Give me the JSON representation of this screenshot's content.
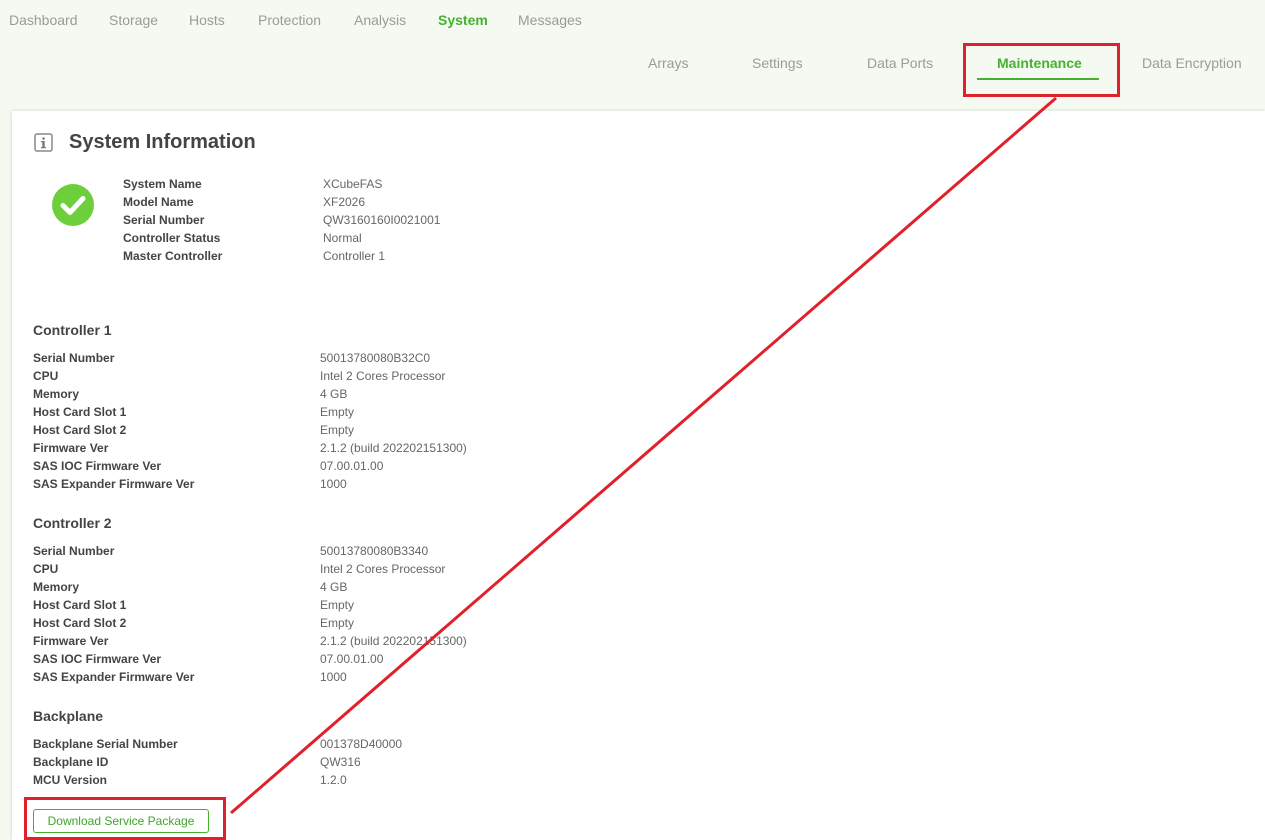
{
  "top_nav": {
    "items": [
      {
        "label": "Dashboard"
      },
      {
        "label": "Storage"
      },
      {
        "label": "Hosts"
      },
      {
        "label": "Protection"
      },
      {
        "label": "Analysis"
      },
      {
        "label": "System"
      },
      {
        "label": "Messages"
      }
    ],
    "active": "System"
  },
  "sub_nav": {
    "items": [
      {
        "label": "Arrays"
      },
      {
        "label": "Settings"
      },
      {
        "label": "Data Ports"
      },
      {
        "label": "Maintenance"
      },
      {
        "label": "Data Encryption"
      }
    ],
    "active": "Maintenance"
  },
  "panel": {
    "title": "System Information",
    "icon": "info-icon",
    "status_icon": "check-circle-icon"
  },
  "system": {
    "rows": [
      {
        "label": "System Name",
        "value": "XCubeFAS"
      },
      {
        "label": "Model Name",
        "value": "XF2026"
      },
      {
        "label": "Serial Number",
        "value": "QW3160160I0021001"
      },
      {
        "label": "Controller Status",
        "value": "Normal"
      },
      {
        "label": "Master Controller",
        "value": "Controller 1"
      }
    ]
  },
  "controller1": {
    "title": "Controller 1",
    "rows": [
      {
        "label": "Serial Number",
        "value": "50013780080B32C0"
      },
      {
        "label": "CPU",
        "value": "Intel 2 Cores Processor"
      },
      {
        "label": "Memory",
        "value": "4 GB"
      },
      {
        "label": "Host Card Slot 1",
        "value": "Empty"
      },
      {
        "label": "Host Card Slot 2",
        "value": "Empty"
      },
      {
        "label": "Firmware Ver",
        "value": "2.1.2 (build 202202151300)"
      },
      {
        "label": "SAS IOC Firmware Ver",
        "value": "07.00.01.00"
      },
      {
        "label": "SAS Expander Firmware Ver",
        "value": "1000"
      }
    ]
  },
  "controller2": {
    "title": "Controller 2",
    "rows": [
      {
        "label": "Serial Number",
        "value": "50013780080B3340"
      },
      {
        "label": "CPU",
        "value": "Intel 2 Cores Processor"
      },
      {
        "label": "Memory",
        "value": "4 GB"
      },
      {
        "label": "Host Card Slot 1",
        "value": "Empty"
      },
      {
        "label": "Host Card Slot 2",
        "value": "Empty"
      },
      {
        "label": "Firmware Ver",
        "value": "2.1.2 (build 202202151300)"
      },
      {
        "label": "SAS IOC Firmware Ver",
        "value": "07.00.01.00"
      },
      {
        "label": "SAS Expander Firmware Ver",
        "value": "1000"
      }
    ]
  },
  "backplane": {
    "title": "Backplane",
    "rows": [
      {
        "label": "Backplane Serial Number",
        "value": "001378D40000"
      },
      {
        "label": "Backplane ID",
        "value": "QW316"
      },
      {
        "label": "MCU Version",
        "value": "1.2.0"
      }
    ]
  },
  "actions": {
    "download_label": "Download Service Package"
  },
  "colors": {
    "accent": "#46b12e",
    "annotation": "#e0202a",
    "background": "#f4faf1"
  }
}
